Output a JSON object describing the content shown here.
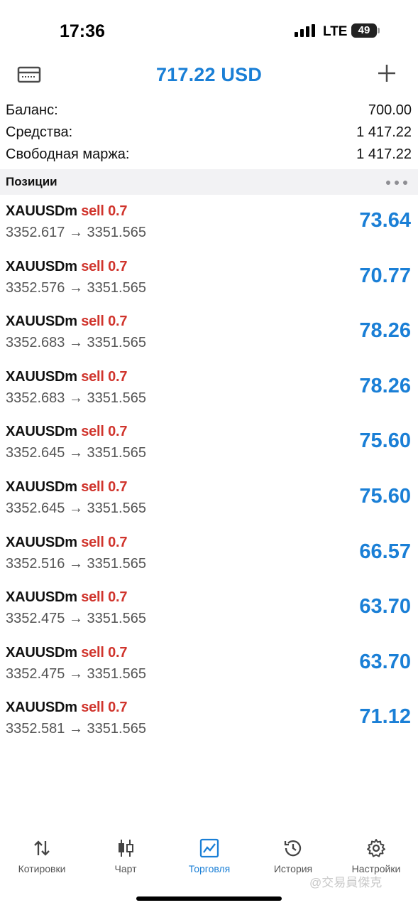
{
  "status_bar": {
    "time": "17:36",
    "network": "LTE",
    "battery": "49"
  },
  "header": {
    "title": "717.22 USD"
  },
  "summary": [
    {
      "label": "Баланс:",
      "value": "700.00"
    },
    {
      "label": "Средства:",
      "value": "1 417.22"
    },
    {
      "label": "Свободная маржа:",
      "value": "1 417.22"
    }
  ],
  "positions_section": {
    "title": "Позиции"
  },
  "positions": [
    {
      "symbol": "XAUUSDm",
      "side": "sell 0.7",
      "prices": "3352.617 → 3351.565",
      "profit": "73.64"
    },
    {
      "symbol": "XAUUSDm",
      "side": "sell 0.7",
      "prices": "3352.576 → 3351.565",
      "profit": "70.77"
    },
    {
      "symbol": "XAUUSDm",
      "side": "sell 0.7",
      "prices": "3352.683 → 3351.565",
      "profit": "78.26"
    },
    {
      "symbol": "XAUUSDm",
      "side": "sell 0.7",
      "prices": "3352.683 → 3351.565",
      "profit": "78.26"
    },
    {
      "symbol": "XAUUSDm",
      "side": "sell 0.7",
      "prices": "3352.645 → 3351.565",
      "profit": "75.60"
    },
    {
      "symbol": "XAUUSDm",
      "side": "sell 0.7",
      "prices": "3352.645 → 3351.565",
      "profit": "75.60"
    },
    {
      "symbol": "XAUUSDm",
      "side": "sell 0.7",
      "prices": "3352.516 → 3351.565",
      "profit": "66.57"
    },
    {
      "symbol": "XAUUSDm",
      "side": "sell 0.7",
      "prices": "3352.475 → 3351.565",
      "profit": "63.70"
    },
    {
      "symbol": "XAUUSDm",
      "side": "sell 0.7",
      "prices": "3352.475 → 3351.565",
      "profit": "63.70"
    },
    {
      "symbol": "XAUUSDm",
      "side": "sell 0.7",
      "prices": "3352.581 → 3351.565",
      "profit": "71.12"
    }
  ],
  "tabs": [
    {
      "label": "Котировки",
      "icon": "quotes-arrows-icon"
    },
    {
      "label": "Чарт",
      "icon": "candlestick-icon"
    },
    {
      "label": "Торговля",
      "icon": "trade-chart-icon",
      "active": true
    },
    {
      "label": "История",
      "icon": "history-clock-icon"
    },
    {
      "label": "Настройки",
      "icon": "gear-icon"
    }
  ],
  "watermark": "@交易員傑克",
  "colors": {
    "accent": "#1a7fd6",
    "sell": "#d0342c",
    "section_bg": "#f2f2f4"
  }
}
